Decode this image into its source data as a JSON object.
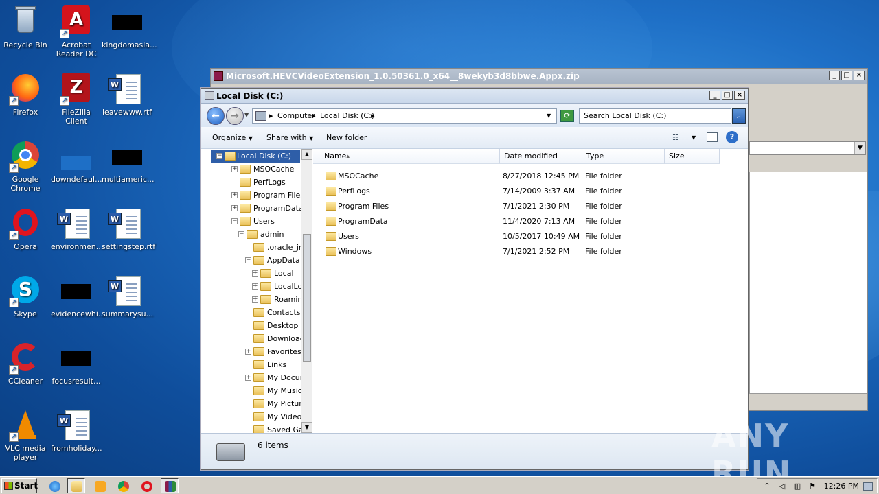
{
  "desktop": {
    "icons": [
      {
        "label": "Recycle Bin"
      },
      {
        "label": "Acrobat Reader DC"
      },
      {
        "label": "kingdomasia..."
      },
      {
        "label": "Firefox"
      },
      {
        "label": "FileZilla Client"
      },
      {
        "label": "leavewww.rtf"
      },
      {
        "label": "Google Chrome"
      },
      {
        "label": "downdefaul..."
      },
      {
        "label": "multiameric..."
      },
      {
        "label": "Opera"
      },
      {
        "label": "environmen..."
      },
      {
        "label": "settingstep.rtf"
      },
      {
        "label": "Skype"
      },
      {
        "label": "evidencewhi..."
      },
      {
        "label": "summarysu..."
      },
      {
        "label": "CCleaner"
      },
      {
        "label": "focusresult..."
      },
      {
        "label": "VLC media player"
      },
      {
        "label": "fromholiday..."
      }
    ]
  },
  "background_window": {
    "title": "Microsoft.HEVCVideoExtension_1.0.50361.0_x64__8wekyb3d8bbwe.Appx.zip"
  },
  "explorer": {
    "title": "Local Disk (C:)",
    "breadcrumb": [
      "Computer",
      "Local Disk (C:)"
    ],
    "search_placeholder": "Search Local Disk (C:)",
    "toolbar": {
      "organize": "Organize",
      "share_with": "Share with",
      "new_folder": "New folder"
    },
    "tree": [
      {
        "label": "Local Disk (C:)",
        "level": 0,
        "expander": "−",
        "selected": true
      },
      {
        "label": "MSOCache",
        "level": 1,
        "expander": "+"
      },
      {
        "label": "PerfLogs",
        "level": 1,
        "expander": ""
      },
      {
        "label": "Program Files",
        "level": 1,
        "expander": "+"
      },
      {
        "label": "ProgramData",
        "level": 1,
        "expander": "+"
      },
      {
        "label": "Users",
        "level": 1,
        "expander": "−"
      },
      {
        "label": "admin",
        "level": 2,
        "expander": "−"
      },
      {
        "label": ".oracle_jre_u",
        "level": 3,
        "expander": ""
      },
      {
        "label": "AppData",
        "level": 3,
        "expander": "−"
      },
      {
        "label": "Local",
        "level": 4,
        "expander": "+"
      },
      {
        "label": "LocalLow",
        "level": 4,
        "expander": "+"
      },
      {
        "label": "Roaming",
        "level": 4,
        "expander": "+"
      },
      {
        "label": "Contacts",
        "level": 3,
        "expander": ""
      },
      {
        "label": "Desktop",
        "level": 3,
        "expander": ""
      },
      {
        "label": "Downloads",
        "level": 3,
        "expander": ""
      },
      {
        "label": "Favorites",
        "level": 3,
        "expander": "+"
      },
      {
        "label": "Links",
        "level": 3,
        "expander": ""
      },
      {
        "label": "My Documen",
        "level": 3,
        "expander": "+"
      },
      {
        "label": "My Music",
        "level": 3,
        "expander": ""
      },
      {
        "label": "My Pictures",
        "level": 3,
        "expander": ""
      },
      {
        "label": "My Videos",
        "level": 3,
        "expander": ""
      },
      {
        "label": "Saved Game",
        "level": 3,
        "expander": ""
      }
    ],
    "columns": [
      "Name",
      "Date modified",
      "Type",
      "Size"
    ],
    "files": [
      {
        "name": "MSOCache",
        "date": "8/27/2018 12:45 PM",
        "type": "File folder",
        "size": ""
      },
      {
        "name": "PerfLogs",
        "date": "7/14/2009 3:37 AM",
        "type": "File folder",
        "size": ""
      },
      {
        "name": "Program Files",
        "date": "7/1/2021 2:30 PM",
        "type": "File folder",
        "size": ""
      },
      {
        "name": "ProgramData",
        "date": "11/4/2020 7:13 AM",
        "type": "File folder",
        "size": ""
      },
      {
        "name": "Users",
        "date": "10/5/2017 10:49 AM",
        "type": "File folder",
        "size": ""
      },
      {
        "name": "Windows",
        "date": "7/1/2021 2:52 PM",
        "type": "File folder",
        "size": ""
      }
    ],
    "status": "6 items"
  },
  "taskbar": {
    "start_label": "Start",
    "clock": "12:26 PM"
  },
  "watermark": "ANY RUN"
}
